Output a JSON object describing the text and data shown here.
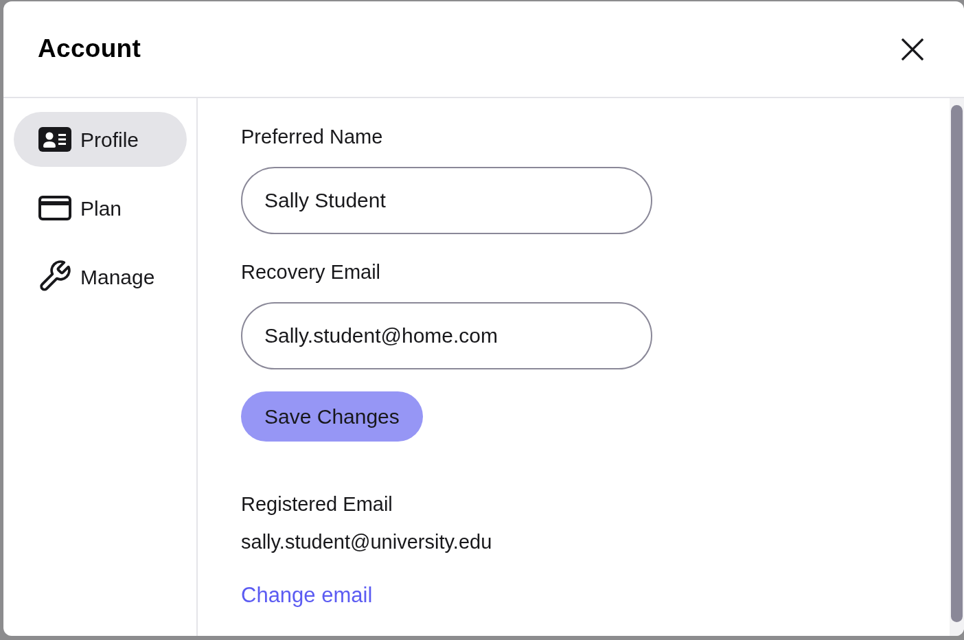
{
  "dialog": {
    "title": "Account"
  },
  "sidebar": {
    "items": [
      {
        "label": "Profile",
        "selected": true
      },
      {
        "label": "Plan",
        "selected": false
      },
      {
        "label": "Manage",
        "selected": false
      }
    ]
  },
  "form": {
    "fields": [
      {
        "label": "Preferred Name",
        "value": "Sally Student"
      },
      {
        "label": "Recovery Email",
        "value": "Sally.student@home.com"
      }
    ],
    "save_button": "Save Changes"
  },
  "registered_email": {
    "label": "Registered Email",
    "value": "sally.student@university.edu",
    "link": "Change email"
  }
}
